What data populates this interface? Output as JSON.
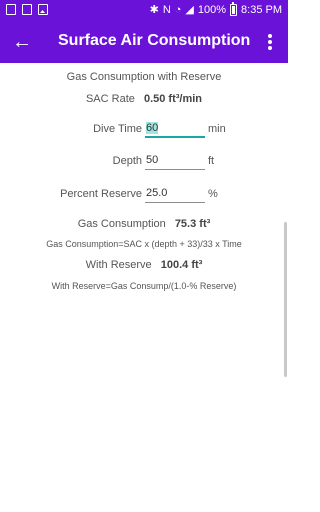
{
  "status": {
    "battery": "100%",
    "time": "8:35 PM"
  },
  "app_bar": {
    "title": "Surface Air Consumption"
  },
  "content": {
    "header": "Gas Consumption with Reserve",
    "sac_label": "SAC Rate",
    "sac_value": "0.50 ft³/min",
    "dive_time": {
      "label": "Dive Time",
      "value": "60",
      "unit": "min"
    },
    "depth": {
      "label": "Depth",
      "value": "50",
      "unit": "ft"
    },
    "reserve": {
      "label": "Percent Reserve",
      "value": "25.0",
      "unit": "%"
    },
    "gas_label": "Gas Consumption",
    "gas_value": "75.3 ft³",
    "gas_formula": "Gas Consumption=SAC x (depth + 33)/33 x Time",
    "with_reserve_label": "With Reserve",
    "with_reserve_value": "100.4 ft³",
    "reserve_formula": "With Reserve=Gas Consump/(1.0-% Reserve)"
  },
  "colors": {
    "primary": "#6a12d8",
    "accent": "#1ca6a0"
  },
  "icons": [
    "notification-icon",
    "download-icon",
    "image-icon",
    "bluetooth-icon",
    "nfc-icon",
    "wifi-icon",
    "signal-icon",
    "battery-icon",
    "back-arrow-icon",
    "overflow-menu-icon"
  ]
}
